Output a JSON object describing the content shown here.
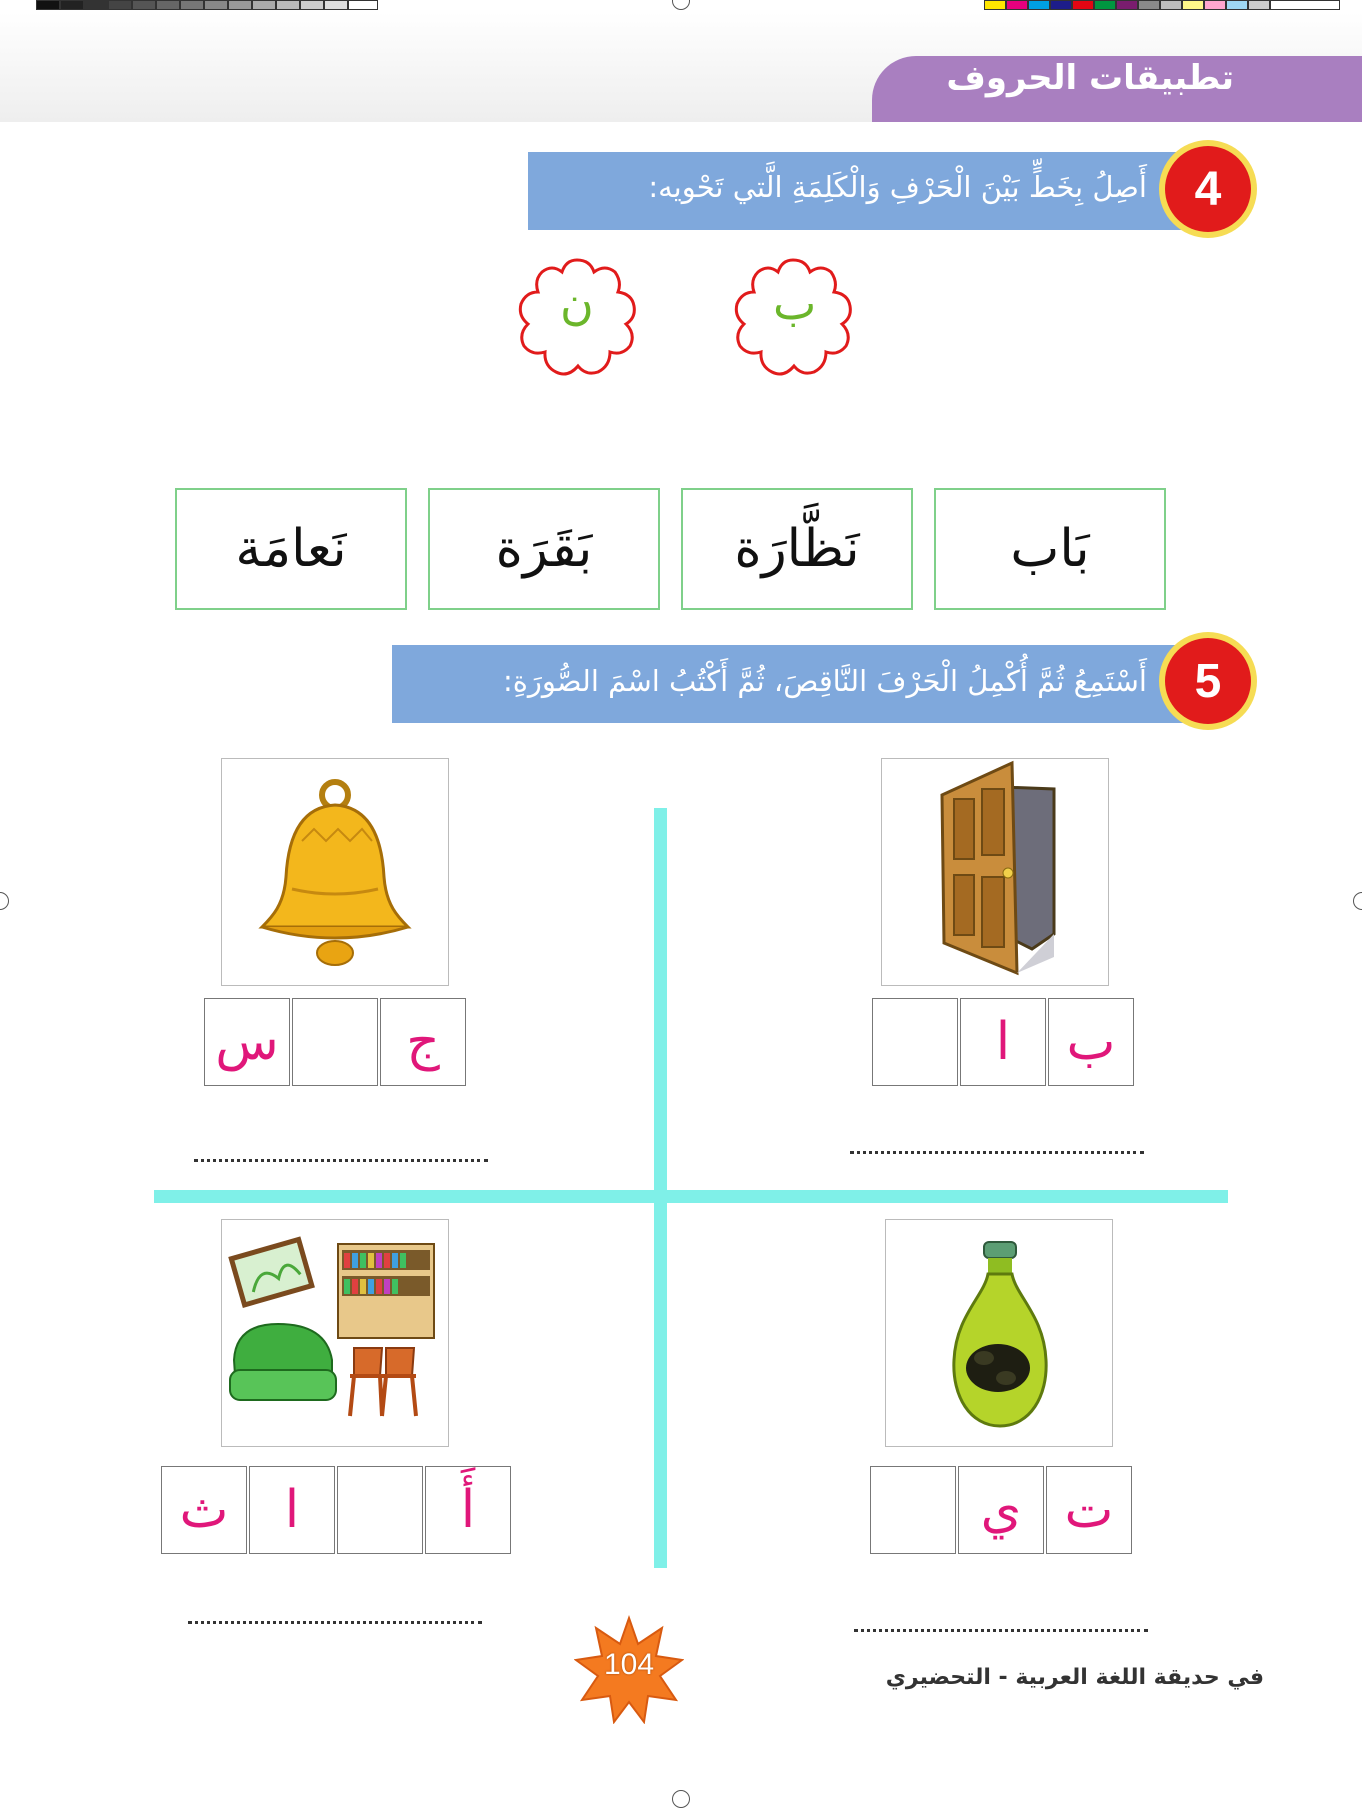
{
  "header": {
    "title": "تطبيقات الحروف"
  },
  "question4": {
    "number": "4",
    "instruction": "أَصِلُ بِخَطٍّ بَيْنَ الْحَرْفِ وَالْكَلِمَةِ الَّتي تَحْويه:",
    "letters": [
      "ب",
      "ن"
    ],
    "words": [
      "بَاب",
      "نَظَّارَة",
      "بَقَرَة",
      "نَعامَة"
    ]
  },
  "question5": {
    "number": "5",
    "instruction": "أَسْتَمِعُ ثُمَّ أُكْمِلُ الْحَرْفَ النَّاقِصَ، ثُمَّ أَكْتُبُ اسْمَ الصُّورَةِ:",
    "items": [
      {
        "picture": "door-icon",
        "cells": [
          "ب",
          "ا",
          ""
        ]
      },
      {
        "picture": "bell-icon",
        "cells": [
          "ج",
          "",
          "س"
        ]
      },
      {
        "picture": "oil-bottle-icon",
        "cells": [
          "ت",
          "ي",
          ""
        ]
      },
      {
        "picture": "furniture-icon",
        "cells": [
          "أَ",
          "",
          "ا",
          "ث"
        ]
      }
    ]
  },
  "footer": {
    "page_number": "104",
    "book_title": "في حديقة اللغة العربية - التحضيري"
  },
  "colors": {
    "header_tab": "#a97fc0",
    "question_bar": "#7fa8dc",
    "number_circle": "#e11b1b",
    "number_ring": "#f6dc54",
    "letter_green": "#6bb62b",
    "cell_letter": "#e0177a",
    "divider": "#7ff0e8",
    "page_badge": "#f47a20"
  }
}
